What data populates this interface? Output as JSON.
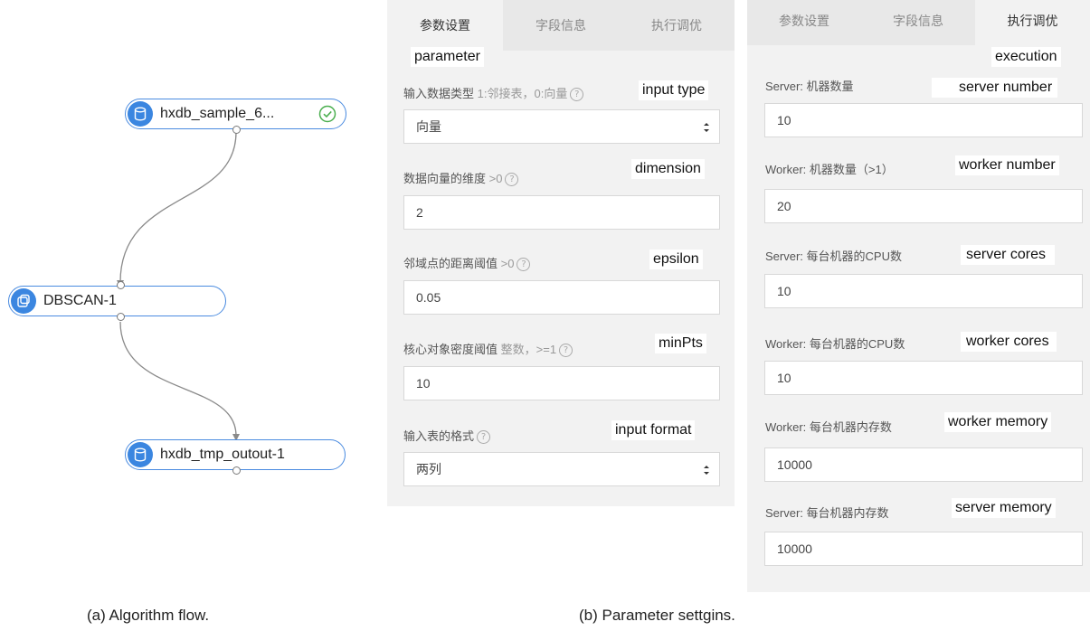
{
  "flow": {
    "nodes": [
      {
        "label": "hxdb_sample_6...",
        "icon": "database-icon",
        "status": "success"
      },
      {
        "label": "DBSCAN-1",
        "icon": "algorithm-icon"
      },
      {
        "label": "hxdb_tmp_outout-1",
        "icon": "database-icon"
      }
    ]
  },
  "param_panel": {
    "tabs": [
      "参数设置",
      "字段信息",
      "执行调优"
    ],
    "annotation": "parameter",
    "fields": [
      {
        "label": "输入数据类型",
        "hint": "1:邻接表，0:向量",
        "value": "向量",
        "type": "select",
        "annotation": "input type"
      },
      {
        "label": "数据向量的维度",
        "hint": ">0",
        "value": "2",
        "type": "input",
        "annotation": "dimension"
      },
      {
        "label": "邻域点的距离阈值",
        "hint": ">0",
        "value": "0.05",
        "type": "input",
        "annotation": "epsilon"
      },
      {
        "label": "核心对象密度阈值",
        "hint": "整数，>=1",
        "value": "10",
        "type": "input",
        "annotation": "minPts"
      },
      {
        "label": "输入表的格式",
        "hint": "",
        "value": "两列",
        "type": "select",
        "annotation": "input format"
      }
    ]
  },
  "exec_panel": {
    "tabs": [
      "参数设置",
      "字段信息",
      "执行调优"
    ],
    "annotation": "execution",
    "fields": [
      {
        "label": "Server: 机器数量",
        "value": "10",
        "annotation": "server number"
      },
      {
        "label": "Worker: 机器数量（>1）",
        "value": "20",
        "annotation": "worker number"
      },
      {
        "label": "Server: 每台机器的CPU数",
        "value": "10",
        "annotation": "server cores"
      },
      {
        "label": "Worker: 每台机器的CPU数",
        "value": "10",
        "annotation": "worker cores"
      },
      {
        "label": "Worker: 每台机器内存数",
        "value": "10000",
        "annotation": "worker memory"
      },
      {
        "label": "Server: 每台机器内存数",
        "value": "10000",
        "annotation": "server memory"
      }
    ]
  },
  "captions": {
    "a": "(a) Algorithm flow.",
    "b": "(b) Parameter settgins."
  },
  "colors": {
    "accent": "#3b86e0",
    "panel_bg": "#f2f2f2",
    "success": "#4caf50"
  }
}
